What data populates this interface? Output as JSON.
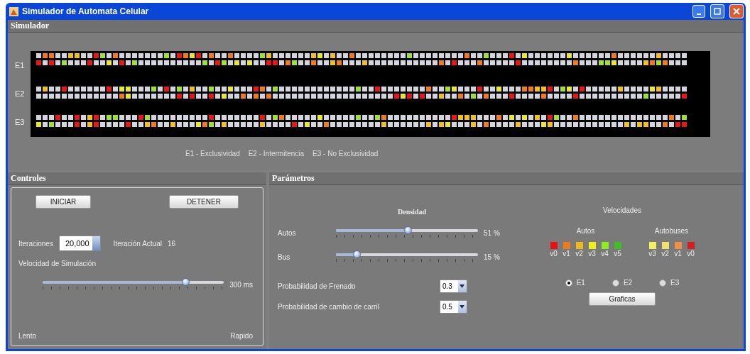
{
  "window": {
    "title": "Simulador de Automata Celular"
  },
  "simulador": {
    "title": "Simulador",
    "lanes": [
      {
        "label": "E1"
      },
      {
        "label": "E2"
      },
      {
        "label": "E3"
      }
    ],
    "legend": [
      "E1 - Exclusividad",
      "E2 - Intermitencia",
      "E3 - No Exclusividad"
    ]
  },
  "controles": {
    "title": "Controles",
    "buttons": [
      "INICIAR",
      "DETENER"
    ],
    "iteraciones_label": "Iteraciones",
    "iteraciones_value": "20,000",
    "iteracion_actual_label": "Iteración Actual",
    "iteracion_actual_value": "16",
    "speed_label": "Velocidad de Simulación",
    "speed_slider": {
      "level": 0.79
    },
    "speed_reading": "300 ms",
    "slow_label": "Lento",
    "fast_label": "Rapido"
  },
  "parametros": {
    "title": "Parámetros",
    "densidad_title": "Densidad",
    "sliders": [
      {
        "label": "Autos",
        "level": 0.51,
        "reading": "51 %"
      },
      {
        "label": "Bus",
        "level": 0.15,
        "reading": "15 %"
      }
    ],
    "combos": [
      {
        "label": "Probabilidad de Frenado",
        "value": "0.3"
      },
      {
        "label": "Probabilidad de cambio de carril",
        "value": "0.5"
      }
    ],
    "velocidades_title": "Velocidades",
    "autos_title": "Autos",
    "autos": [
      {
        "label": "v0",
        "color": "#e81010"
      },
      {
        "label": "v1",
        "color": "#f07a18"
      },
      {
        "label": "v2",
        "color": "#f0b818"
      },
      {
        "label": "v3",
        "color": "#f0f018"
      },
      {
        "label": "v4",
        "color": "#8cf020"
      },
      {
        "label": "v5",
        "color": "#40c020"
      }
    ],
    "buses_title": "Autobuses",
    "buses": [
      {
        "label": "v3",
        "color": "#f0f060"
      },
      {
        "label": "v2",
        "color": "#f0e070"
      },
      {
        "label": "v1",
        "color": "#f09048"
      },
      {
        "label": "v0",
        "color": "#d02020"
      }
    ],
    "radios": [
      {
        "label": "E1",
        "selected": true
      },
      {
        "label": "E2",
        "selected": false
      },
      {
        "label": "E3",
        "selected": false
      }
    ],
    "graph_button": "Graficas"
  }
}
